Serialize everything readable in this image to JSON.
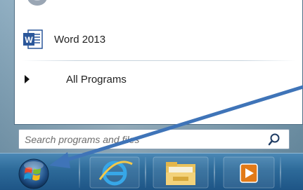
{
  "start_menu": {
    "pinned_items": [
      {
        "label": "Word 2013",
        "icon": "word-icon"
      }
    ],
    "all_programs_label": "All Programs",
    "search": {
      "placeholder": "Search programs and files",
      "value": ""
    }
  },
  "taskbar": {
    "buttons": [
      {
        "name": "start-orb",
        "icon": "windows-logo-icon"
      },
      {
        "name": "internet-explorer",
        "icon": "internet-explorer-icon"
      },
      {
        "name": "file-explorer",
        "icon": "folder-icon"
      },
      {
        "name": "media-player",
        "icon": "media-player-icon"
      }
    ]
  },
  "annotation": {
    "arrow_color": "#3f74b8",
    "points_to": "start-orb"
  },
  "colors": {
    "taskbar": "#2d6a99",
    "word_blue": "#2b579a",
    "glass": "#8fb0c4"
  }
}
